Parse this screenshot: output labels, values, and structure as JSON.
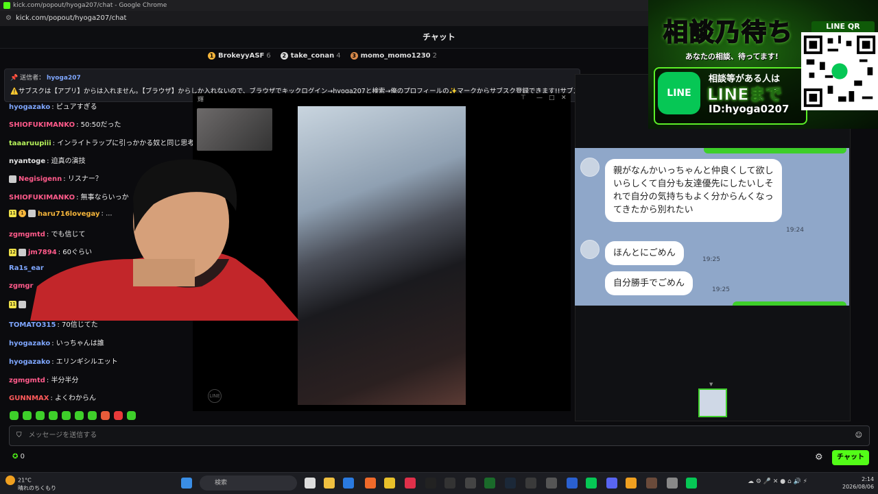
{
  "window": {
    "title": "kick.com/popout/hyoga207/chat - Google Chrome",
    "url": "kick.com/popout/hyoga207/chat"
  },
  "chat": {
    "header": "チャット",
    "leaderboard": [
      {
        "rank": "1",
        "name": "BrokeyyASF",
        "count": "6",
        "color": "#f5b53b"
      },
      {
        "rank": "2",
        "name": "take_conan",
        "count": "4",
        "color": "#d9d9d9"
      },
      {
        "rank": "3",
        "name": "momo_momo1230",
        "count": "2",
        "color": "#d8894a"
      }
    ],
    "pinned": {
      "label": "送信者：",
      "user": "hyoga207",
      "text": "⚠️サブスクは【アプリ】からは入れません。【ブラウザ】からしか入れないので、ブラウザでキックログイン→hyoga207と検索→俺のプロフィールの✨マークからサブスク登録できます!!サブスク"
    },
    "messages": [
      {
        "user": "hyogazako",
        "color": "#7fa7ff",
        "text": ": ピュアすぎる"
      },
      {
        "user": "SHIOFUKIMANKO",
        "color": "#ff5a8a",
        "text": ": 50:50だった"
      },
      {
        "user": "taaaruupiii",
        "color": "#b6f25a",
        "text": ": インライトラップに引っかかる奴と同じ思考回路"
      },
      {
        "user": "nyantoge",
        "color": "#e6e6e6",
        "text": ": 迫真の演技"
      },
      {
        "user": "Negisigenn",
        "color": "#ff5a8a",
        "text": ": リスナー？"
      },
      {
        "user": "SHIOFUKIMANKO",
        "color": "#ff5a8a",
        "text": ": 無事ならいっか"
      },
      {
        "user": "haru716lovegay",
        "color": "#f5b53b",
        "text": ": ..."
      },
      {
        "user": "zgmgmtd",
        "color": "#ff5a8a",
        "text": ": でも信じて"
      },
      {
        "user": "jm7894",
        "color": "#ff5a8a",
        "text": ": 60ぐらい"
      },
      {
        "user": "Ra1s_ear",
        "color": "#7fa7ff",
        "text": ""
      },
      {
        "user": "zgmgr",
        "color": "#ff5a8a",
        "text": ""
      },
      {
        "user": "TOMATO315",
        "color": "#7fa7ff",
        "text": ": 70信じてた"
      },
      {
        "user": "hyogazako",
        "color": "#7fa7ff",
        "text": ": いっちゃんは誰"
      },
      {
        "user": "hyogazako",
        "color": "#7fa7ff",
        "text": ": エリンギシルエット"
      },
      {
        "user": "zgmgmtd",
        "color": "#ff5a8a",
        "text": ": 半分半分"
      },
      {
        "user": "GUNNMAX",
        "color": "#ff5a5a",
        "text": ": よくわからん"
      }
    ],
    "badges": {
      "b11": "11",
      "b12": "12",
      "b1": "1"
    },
    "composer_placeholder": "メッセージを送信する",
    "points": "0",
    "send_label": "チャット"
  },
  "call": {
    "title_char": "輝",
    "line_watermark": "LINE"
  },
  "line_chat": {
    "messages": [
      {
        "text": "親がなんかいっちゃんと仲良くして欲しいらしくて自分も友達優先にしたいしそれで自分の気持ちもよく分からんくなってきたから別れたい",
        "time": "19:24"
      },
      {
        "text": "ほんとにごめん",
        "time": "19:25"
      },
      {
        "text": "自分勝手でごめん",
        "time": "19:25"
      }
    ]
  },
  "banner": {
    "headline": "相談乃待ち",
    "subtitle": "あなたの相談、待ってます!",
    "line_logo": "LINE",
    "text1": "相談等がある人は",
    "text2": "LINEまで",
    "text3": "ID:hyoga0207",
    "qr_label": "LINE QR"
  },
  "taskbar": {
    "temperature": "21°C",
    "weather": "晴れのちくもり",
    "search_placeholder": "検索",
    "time": "2:14",
    "date": "2026/08/06"
  },
  "colors": {
    "kick_green": "#53fc18",
    "line_green": "#06c755",
    "line_bg": "#8fa7c9"
  }
}
